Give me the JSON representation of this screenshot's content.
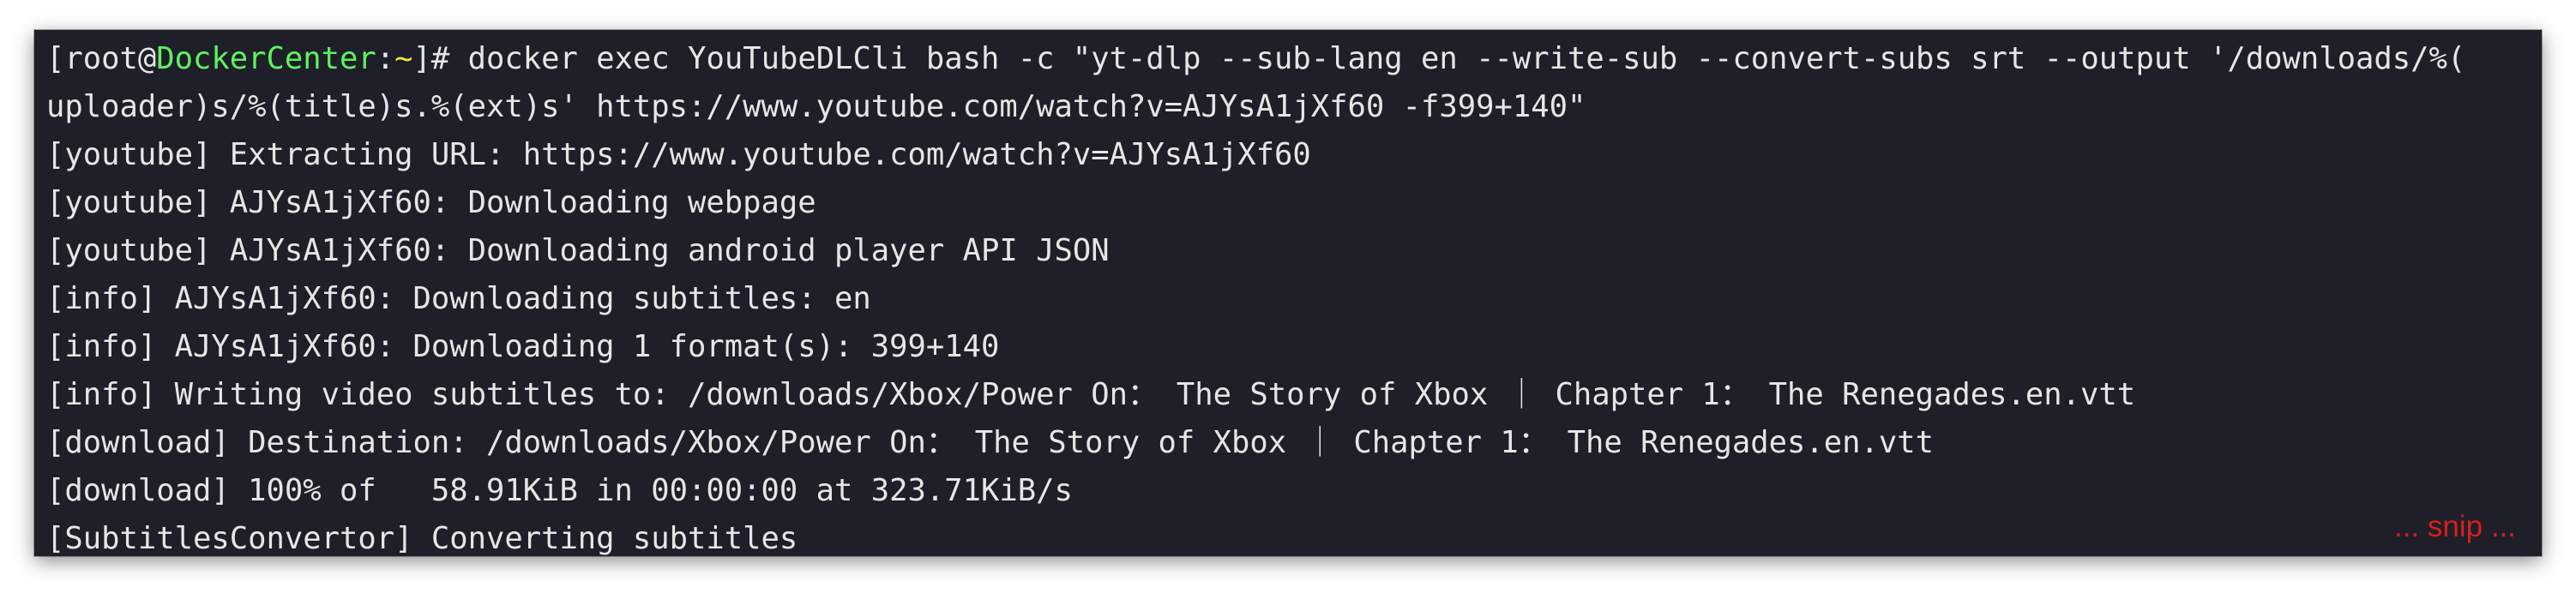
{
  "terminal": {
    "prompt": {
      "open": "[root@",
      "host": "DockerCenter",
      "colon": ":",
      "path": "~",
      "close": "]# "
    },
    "command_line_1": "docker exec YouTubeDLCli bash -c \"yt-dlp --sub-lang en --write-sub --convert-subs srt --output '/downloads/%(",
    "command_line_2": "uploader)s/%(title)s.%(ext)s' https://www.youtube.com/watch?v=AJYsA1jXf60 -f399+140\"",
    "output_lines": [
      "[youtube] Extracting URL: https://www.youtube.com/watch?v=AJYsA1jXf60",
      "[youtube] AJYsA1jXf60: Downloading webpage",
      "[youtube] AJYsA1jXf60: Downloading android player API JSON",
      "[info] AJYsA1jXf60: Downloading subtitles: en",
      "[info] AJYsA1jXf60: Downloading 1 format(s): 399+140",
      "[info] Writing video subtitles to: /downloads/Xbox/Power On： The Story of Xbox ｜ Chapter 1： The Renegades.en.vtt",
      "[download] Destination: /downloads/Xbox/Power On： The Story of Xbox ｜ Chapter 1： The Renegades.en.vtt",
      "[download] 100% of   58.91KiB in 00:00:00 at 323.71KiB/s",
      "[SubtitlesConvertor] Converting subtitles"
    ],
    "snip_note": "... snip ..."
  },
  "colors": {
    "background": "#1e1f29",
    "text": "#e6e6e6",
    "hostname": "#5ff25f",
    "cwd": "#f0e442",
    "snip": "#d81e1e"
  }
}
